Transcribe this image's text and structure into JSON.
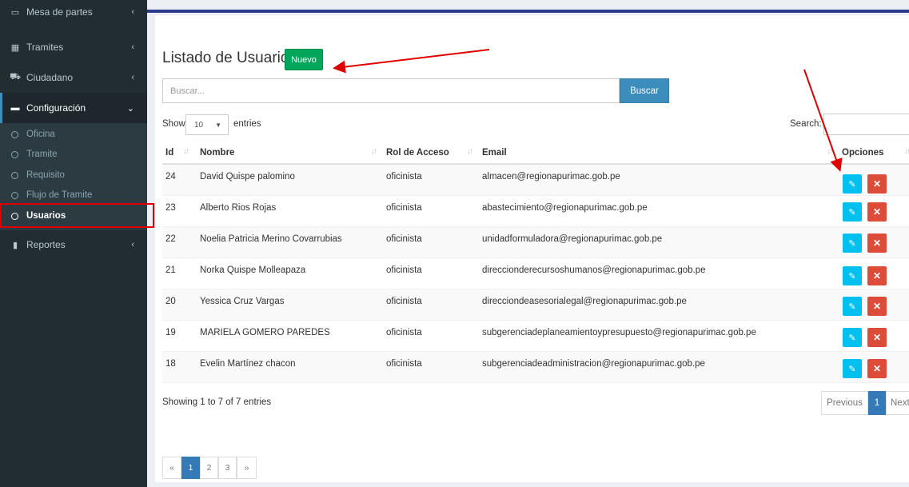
{
  "sidebar": {
    "items": [
      {
        "label": "Mesa de partes",
        "icon": "laptop-icon"
      },
      {
        "label": "Tramites",
        "icon": "grid-icon"
      },
      {
        "label": "Ciudadano",
        "icon": "cart-icon"
      },
      {
        "label": "Configuración",
        "icon": "folder-icon"
      },
      {
        "label": "Reportes",
        "icon": "bar-chart-icon"
      }
    ],
    "submenu": [
      "Oficina",
      "Tramite",
      "Requisito",
      "Flujo de Tramite",
      "Usuarios"
    ]
  },
  "page": {
    "title": "Listado de Usuarios",
    "new_button": "Nuevo"
  },
  "search": {
    "placeholder": "Buscar...",
    "button": "Buscar"
  },
  "datatable": {
    "show_label": "Show",
    "length_value": "10",
    "entries_label": "entries",
    "search_label": "Search:",
    "info": "Showing 1 to 7 of 7 entries",
    "previous": "Previous",
    "current_page": "1",
    "next": "Next"
  },
  "table": {
    "headers": [
      "Id",
      "Nombre",
      "Rol de Acceso",
      "Email",
      "Opciones"
    ],
    "rows": [
      [
        "24",
        "David Quispe palomino",
        "oficinista",
        "almacen@regionapurimac.gob.pe"
      ],
      [
        "23",
        "Alberto Rios Rojas",
        "oficinista",
        "abastecimiento@regionapurimac.gob.pe"
      ],
      [
        "22",
        "Noelia Patricia Merino Covarrubias",
        "oficinista",
        "unidadformuladora@regionapurimac.gob.pe"
      ],
      [
        "21",
        "Norka Quispe Molleapaza",
        "oficinista",
        "direccionderecursoshumanos@regionapurimac.gob.pe"
      ],
      [
        "20",
        "Yessica Cruz Vargas",
        "oficinista",
        "direcciondeasesorialegal@regionapurimac.gob.pe"
      ],
      [
        "19",
        "MARIELA GOMERO PAREDES",
        "oficinista",
        "subgerenciadeplaneamientoypresupuesto@regionapurimac.gob.pe"
      ],
      [
        "18",
        "Evelin Martínez chacon",
        "oficinista",
        "subgerenciadeadministracion@regionapurimac.gob.pe"
      ]
    ]
  },
  "pager": {
    "first": "«",
    "pages": [
      "1",
      "2",
      "3"
    ],
    "last": "»"
  },
  "colors": {
    "sidebar_bg": "#222d32",
    "success": "#00a65a",
    "primary": "#3c8dbc",
    "info": "#00c0ef",
    "danger": "#dd4b39",
    "annotation": "#e00000"
  }
}
